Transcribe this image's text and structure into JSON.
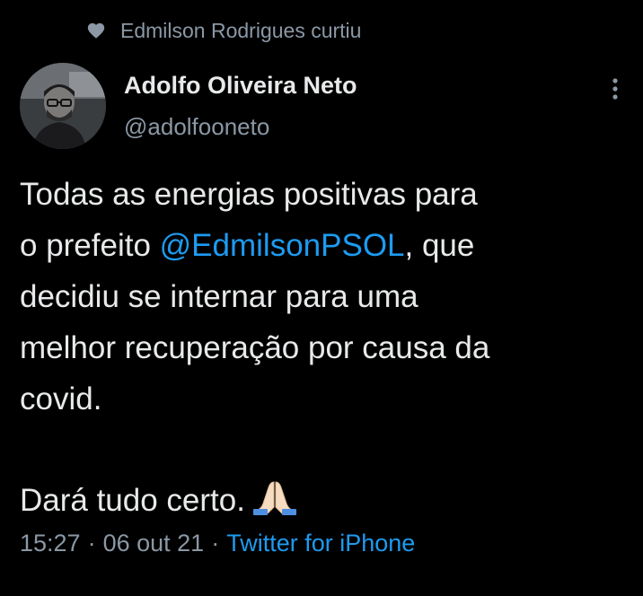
{
  "social_context": {
    "icon": "heart-icon",
    "text": "Edmilson Rodrigues curtiu"
  },
  "author": {
    "name": "Adolfo Oliveira Neto",
    "handle": "@adolfooneto",
    "avatar_icon": "avatar"
  },
  "more_icon": "more-vertical-icon",
  "tweet": {
    "line1": "Todas as energias positivas para",
    "line2_before": "o prefeito ",
    "mention": "@EdmilsonPSOL",
    "line2_after": ", que",
    "line3": "decidiu se internar para uma",
    "line4": "melhor recuperação por causa da",
    "line5": "covid.",
    "closing": "Dará tudo certo.",
    "closing_emoji": "praying-hands-icon"
  },
  "meta": {
    "time": "15:27",
    "date": "06 out 21",
    "separator": "·",
    "source": "Twitter for iPhone"
  },
  "colors": {
    "background": "#000000",
    "text_primary": "#e7e9ea",
    "text_secondary": "#8b98a5",
    "accent": "#1d9bf0"
  }
}
